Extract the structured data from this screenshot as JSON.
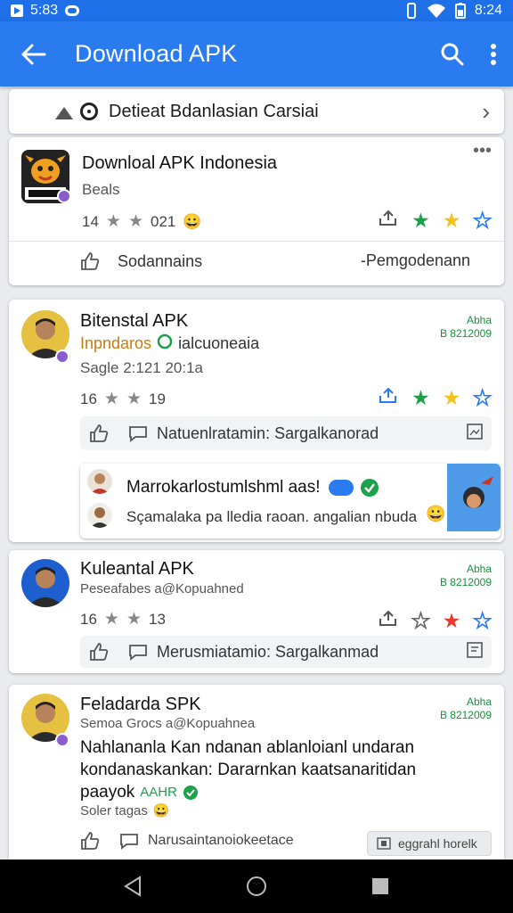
{
  "status_bar": {
    "time_left": "5:83",
    "time_right": "8:24"
  },
  "app_bar": {
    "title": "Download APK"
  },
  "banner": {
    "text": "Detieat Bdanlasian Carsiai"
  },
  "cards": [
    {
      "title": "Downloal APK Indonesia",
      "sub": "Beals",
      "meta_count": "14",
      "meta_value": "021",
      "action_left": "Sodannains",
      "action_right": "-Pemgodenann"
    },
    {
      "title": "Bitenstal APK",
      "org": "Inpndaros",
      "org_suffix": "ialcuoneaia",
      "sub": "Sagle 2:121 20:1a",
      "meta_count": "16",
      "meta_value": "19",
      "date_top": "Abha",
      "date_bottom": "B 8212009",
      "action_text": "Natuenlratamin: Sargalkanorad",
      "nested_title": "Marrokarlostumlshml aas!",
      "nested_sub": "Sçamalaka pa lledia raoan. angalian nbuda"
    },
    {
      "title": "Kuleantal APK",
      "sub": "Peseafabes a@Kopuahned",
      "meta_count": "16",
      "meta_value": "13",
      "date_top": "Abha",
      "date_bottom": "B 8212009",
      "action_text": "Merusmiatamio: Sargalkanmad"
    },
    {
      "title": "Feladarda SPK",
      "sub": "Semoa Grocs a@Kopuahnea",
      "body_lines": [
        "Nahlananla Kan ndanan ablanloianl undaran",
        "kondanaskankan: Dararnkan kaatsanaritidan",
        "paayok"
      ],
      "body_tag": "AAHR",
      "sub2": "Soler tagas",
      "date_top": "Abha",
      "date_bottom": "B 8212009",
      "action_text": "Narusaintanoiokeetace",
      "pill_text": "eggrahl horelk"
    }
  ],
  "colors": {
    "primary": "#2a7bf0",
    "status_bar": "#1f6fe8",
    "green": "#1aa14a",
    "yellow": "#f5c01a",
    "red": "#e53b2f"
  }
}
